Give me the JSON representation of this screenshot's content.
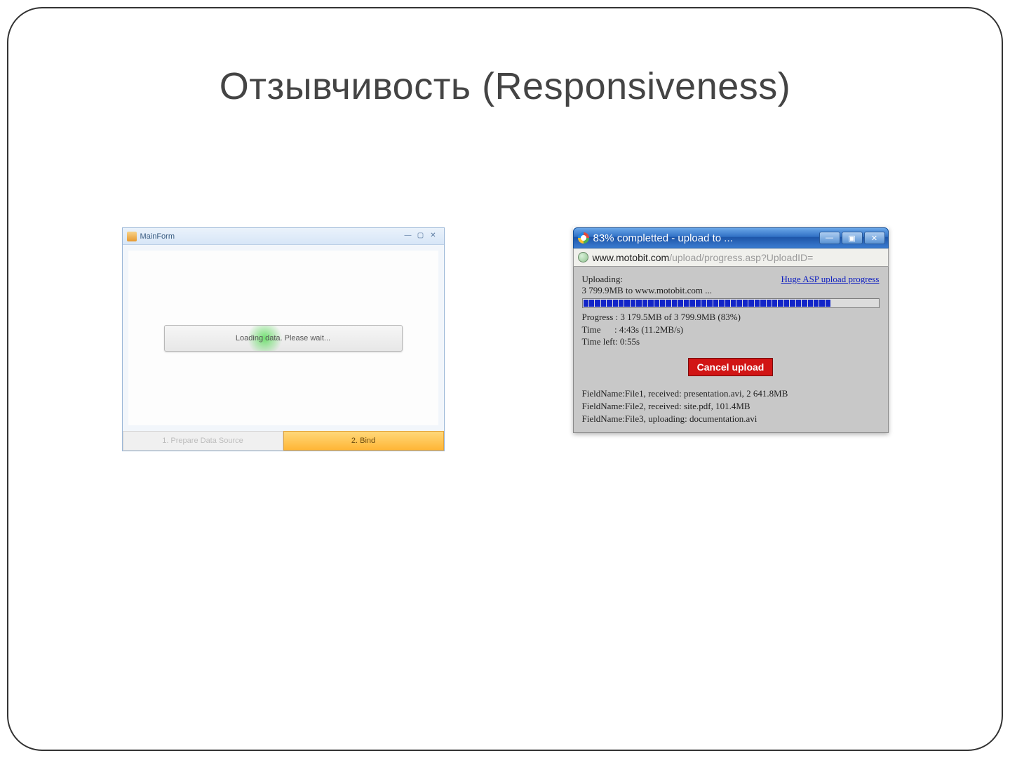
{
  "slide": {
    "title": "Отзывчивость (Responsiveness)"
  },
  "mainform": {
    "title": "MainForm",
    "loading_text": "Loading data. Please wait...",
    "step1": "1. Prepare Data Source",
    "step2": "2. Bind",
    "btn_min": "—",
    "btn_max": "▢",
    "btn_close": "✕"
  },
  "upload": {
    "title": "83% completted - upload to ...",
    "url_domain": "www.motobit.com",
    "url_path": "/upload/progress.asp?UploadID=",
    "uploading_label": "Uploading:",
    "link_text": "Huge ASP upload progress",
    "dest_line": "3 799.9MB to www.motobit.com ...",
    "progress_line": "Progress : 3 179.5MB of 3 799.9MB (83%)",
    "time_line": "Time      : 4:43s (11.2MB/s)",
    "timeleft_line": "Time left: 0:55s",
    "cancel_label": "Cancel upload",
    "file1": "FieldName:File1, received: presentation.avi, 2 641.8MB",
    "file2": "FieldName:File2, received: site.pdf, 101.4MB",
    "file3": "FieldName:File3, uploading: documentation.avi",
    "btn_min": "—",
    "btn_max": "▣",
    "btn_close": "✕",
    "progress_filled": 42,
    "progress_total": 50
  }
}
